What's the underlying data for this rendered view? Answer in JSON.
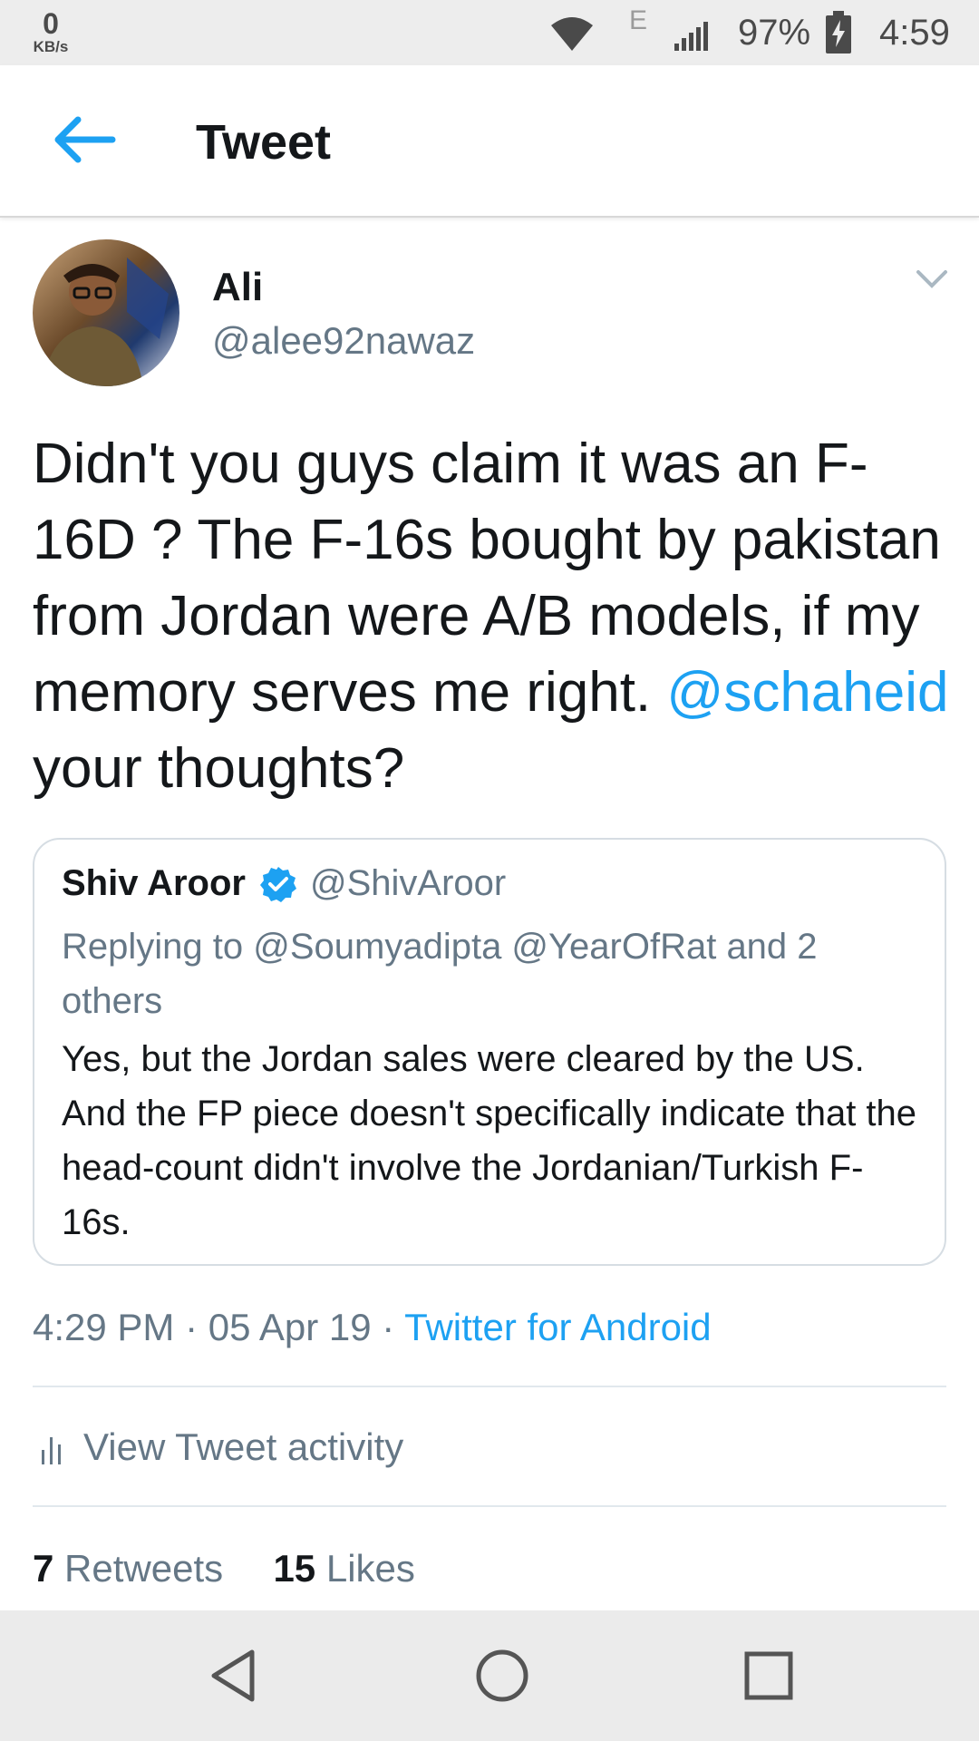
{
  "status_bar": {
    "net_speed": "0",
    "net_unit": "KB/s",
    "network_type": "E",
    "battery": "97%",
    "time": "4:59"
  },
  "header": {
    "title": "Tweet"
  },
  "tweet": {
    "author_name": "Ali",
    "author_handle": "@alee92nawaz",
    "text_before": "Didn't you guys claim it was an F-16D ? The F-16s bought by pakistan from Jordan were A/B models, if my memory serves me right. ",
    "mention": "@schaheid",
    "text_after": " your thoughts?",
    "time": "4:29 PM",
    "date": "05 Apr 19",
    "source": "Twitter for Android"
  },
  "quote": {
    "name": "Shiv Aroor",
    "handle": "@ShivAroor",
    "replying_to": "Replying to @Soumyadipta @YearOfRat and 2 others",
    "text": "Yes, but the Jordan sales were cleared by the US. And the FP piece doesn't specifically indicate that the head-count didn't involve the Jordanian/Turkish F-16s."
  },
  "activity": {
    "label": "View Tweet activity"
  },
  "stats": {
    "retweets_count": "7",
    "retweets_label": "Retweets",
    "likes_count": "15",
    "likes_label": "Likes"
  },
  "colors": {
    "accent": "#1da1f2",
    "secondary_text": "#657786",
    "primary_text": "#14171a"
  }
}
